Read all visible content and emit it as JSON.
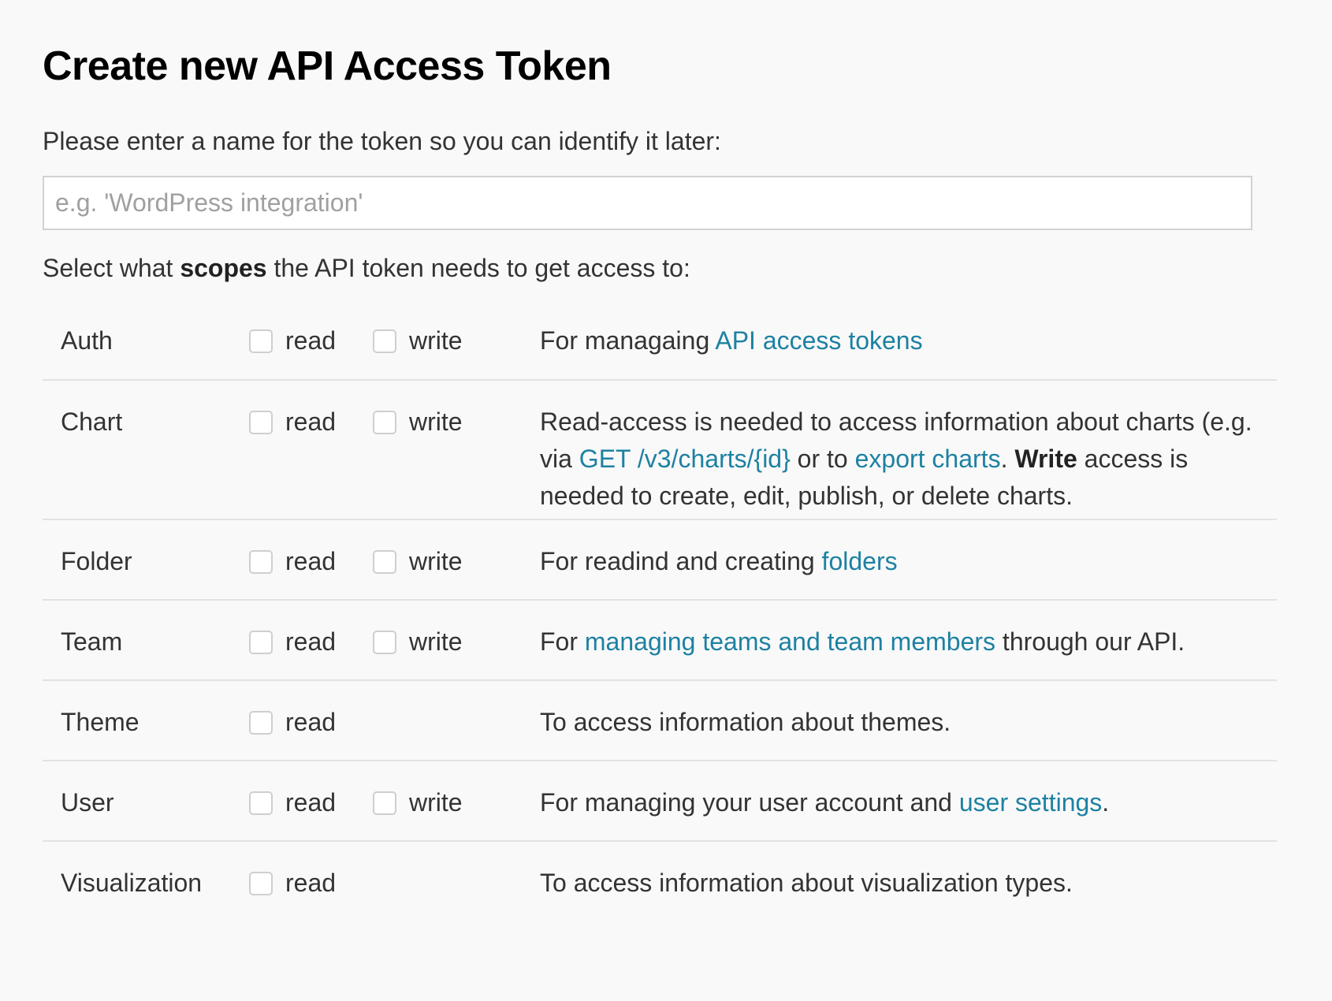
{
  "title": "Create new API Access Token",
  "intro": "Please enter a name for the token so you can identify it later:",
  "name_input": {
    "placeholder": "e.g. 'WordPress integration'",
    "value": ""
  },
  "scopes_intro": {
    "before": "Select what ",
    "bold": "scopes",
    "after": " the API token needs to get access to:"
  },
  "perm_labels": {
    "read": "read",
    "write": "write"
  },
  "colors": {
    "link": "#1d81a2",
    "divider": "#e2e2e2",
    "background": "#f9f9f9"
  },
  "scopes": {
    "auth": {
      "name": "Auth",
      "desc": {
        "t1": "For managaing ",
        "link1": "API access tokens"
      }
    },
    "chart": {
      "name": "Chart",
      "desc": {
        "t1": "Read-access is needed to access information about charts (e.g. via ",
        "link1": "GET /v3/charts/{id}",
        "t2": " or to ",
        "link2": "export charts",
        "t3": ". ",
        "bold": "Write",
        "t4": " access is needed to create, edit, publish, or delete charts."
      }
    },
    "folder": {
      "name": "Folder",
      "desc": {
        "t1": "For readind and creating ",
        "link1": "folders"
      }
    },
    "team": {
      "name": "Team",
      "desc": {
        "t1": "For ",
        "link1": "managing teams and team members",
        "t2": " through our API."
      }
    },
    "theme": {
      "name": "Theme",
      "desc": {
        "t1": "To access information about themes."
      }
    },
    "user": {
      "name": "User",
      "desc": {
        "t1": "For managing your user account and ",
        "link1": "user settings",
        "t2": "."
      }
    },
    "visualization": {
      "name": "Visualization",
      "desc": {
        "t1": "To access information about visualization types."
      }
    }
  }
}
